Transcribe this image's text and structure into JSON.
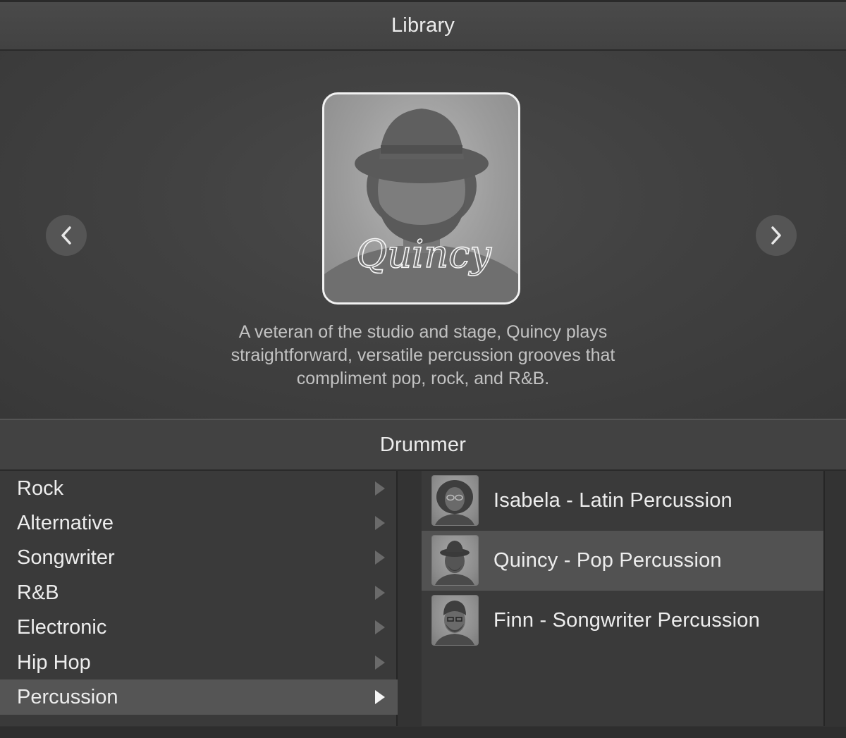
{
  "window": {
    "title": "Library"
  },
  "hero": {
    "prev_icon": "chevron-left-icon",
    "next_icon": "chevron-right-icon",
    "signature": "Quincy",
    "description_lines": [
      "A veteran of the studio and stage, Quincy plays",
      "straightforward, versatile percussion grooves that",
      "compliment pop, rock, and R&B."
    ]
  },
  "section": {
    "title": "Drummer"
  },
  "genres": [
    {
      "label": "Rock",
      "selected": false
    },
    {
      "label": "Alternative",
      "selected": false
    },
    {
      "label": "Songwriter",
      "selected": false
    },
    {
      "label": "R&B",
      "selected": false
    },
    {
      "label": "Electronic",
      "selected": false
    },
    {
      "label": "Hip Hop",
      "selected": false
    },
    {
      "label": "Percussion",
      "selected": true
    }
  ],
  "drummers": [
    {
      "label": "Isabela - Latin Percussion",
      "selected": false,
      "avatar": "isabela-avatar"
    },
    {
      "label": "Quincy - Pop Percussion",
      "selected": true,
      "avatar": "quincy-avatar"
    },
    {
      "label": "Finn - Songwriter Percussion",
      "selected": false,
      "avatar": "finn-avatar"
    }
  ],
  "colors": {
    "background": "#2e2e2e",
    "selected_row": "#555555",
    "text": "#ededed",
    "description_text": "#c2c2c2",
    "portrait_border": "#f2f2f2"
  }
}
